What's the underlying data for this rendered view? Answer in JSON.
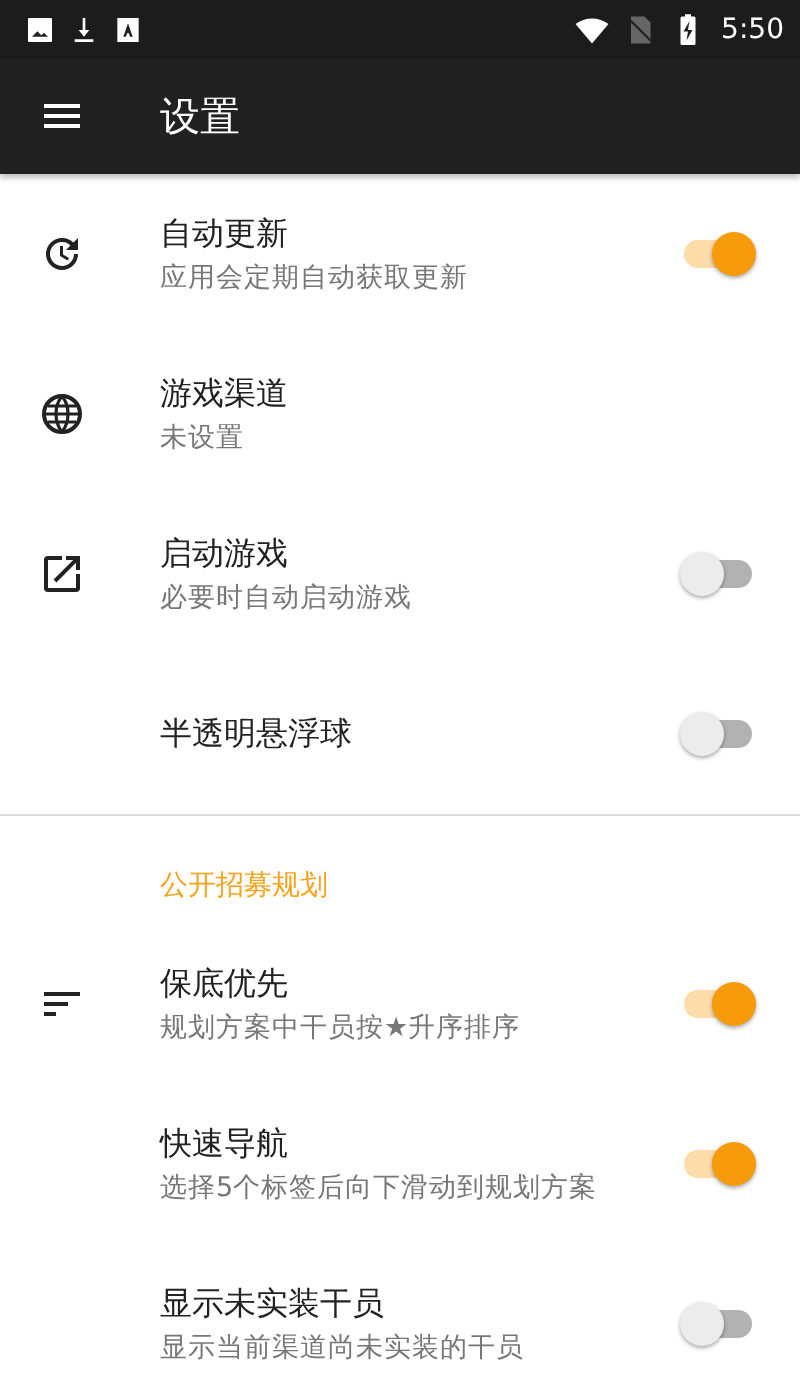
{
  "status_bar": {
    "time": "5:50"
  },
  "toolbar": {
    "title": "设置"
  },
  "sections": [
    {
      "items": [
        {
          "kind": "switch",
          "title": "自动更新",
          "subtitle": "应用会定期自动获取更新",
          "on": true
        },
        {
          "kind": "text",
          "title": "游戏渠道",
          "subtitle": "未设置"
        },
        {
          "kind": "switch",
          "title": "启动游戏",
          "subtitle": "必要时自动启动游戏",
          "on": false
        },
        {
          "kind": "switch",
          "title": "半透明悬浮球",
          "on": false
        }
      ]
    },
    {
      "header": "公开招募规划",
      "items": [
        {
          "kind": "switch",
          "title": "保底优先",
          "subtitle": "规划方案中干员按★升序排序",
          "on": true
        },
        {
          "kind": "switch",
          "title": "快速导航",
          "subtitle": "选择5个标签后向下滑动到规划方案",
          "on": true
        },
        {
          "kind": "switch",
          "title": "显示未实装干员",
          "subtitle": "显示当前渠道尚未实装的干员",
          "on": false
        }
      ]
    }
  ]
}
